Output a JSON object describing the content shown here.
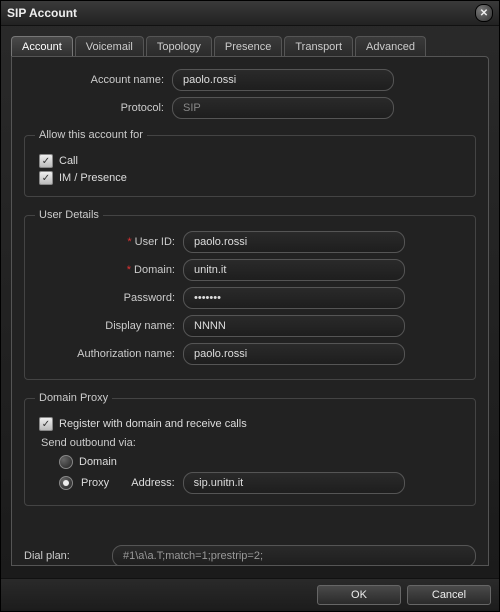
{
  "title": "SIP Account",
  "tabs": {
    "t0": "Account",
    "t1": "Voicemail",
    "t2": "Topology",
    "t3": "Presence",
    "t4": "Transport",
    "t5": "Advanced"
  },
  "labels": {
    "account_name": "Account name:",
    "protocol": "Protocol:",
    "allow_legend": "Allow this account for",
    "call": "Call",
    "im": "IM / Presence",
    "user_details": "User Details",
    "user_id": "User ID:",
    "domain": "Domain:",
    "password": "Password:",
    "display_name": "Display name:",
    "auth_name": "Authorization name:",
    "domain_proxy": "Domain Proxy",
    "register": "Register with domain and receive calls",
    "send_outbound": "Send outbound via:",
    "radio_domain": "Domain",
    "radio_proxy": "Proxy",
    "address": "Address:",
    "dial_plan": "Dial plan:"
  },
  "values": {
    "account_name": "paolo.rossi",
    "protocol": "SIP",
    "user_id": "paolo.rossi",
    "domain": "unitn.it",
    "password": "•••••••",
    "display_name": "NNNN",
    "auth_name": "paolo.rossi",
    "proxy_address": "sip.unitn.it",
    "dial_plan": "#1\\a\\a.T;match=1;prestrip=2;"
  },
  "buttons": {
    "ok": "OK",
    "cancel": "Cancel"
  },
  "asterisk": "*"
}
